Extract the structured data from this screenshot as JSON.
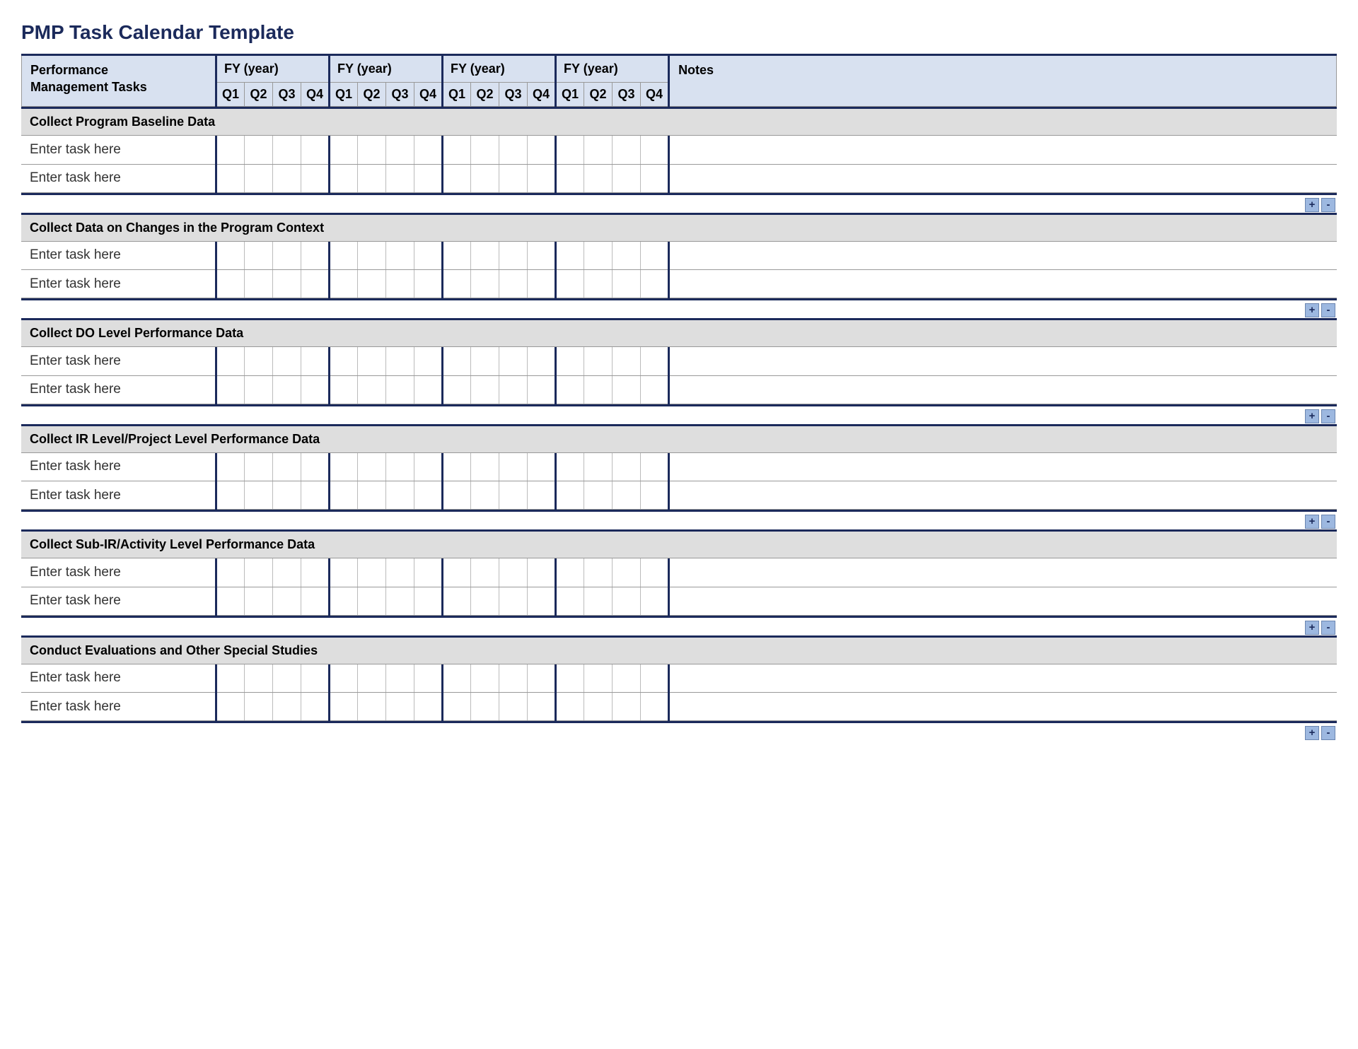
{
  "title": "PMP Task Calendar Template",
  "header": {
    "tasks_label_line1": "Performance",
    "tasks_label_line2": "Management Tasks",
    "fy_label": "FY  (year)",
    "quarters": [
      "Q1",
      "Q2",
      "Q3",
      "Q4"
    ],
    "notes_label": "Notes"
  },
  "btn": {
    "plus": "+",
    "minus": "-"
  },
  "task_placeholder": "Enter task here",
  "sections": [
    {
      "title": "Collect Program Baseline Data"
    },
    {
      "title": "Collect Data on Changes in the Program Context"
    },
    {
      "title": "Collect DO Level Performance Data"
    },
    {
      "title": "Collect IR Level/Project Level Performance Data"
    },
    {
      "title": "Collect Sub-IR/Activity Level Performance Data"
    },
    {
      "title": "Conduct Evaluations and Other Special Studies"
    }
  ]
}
